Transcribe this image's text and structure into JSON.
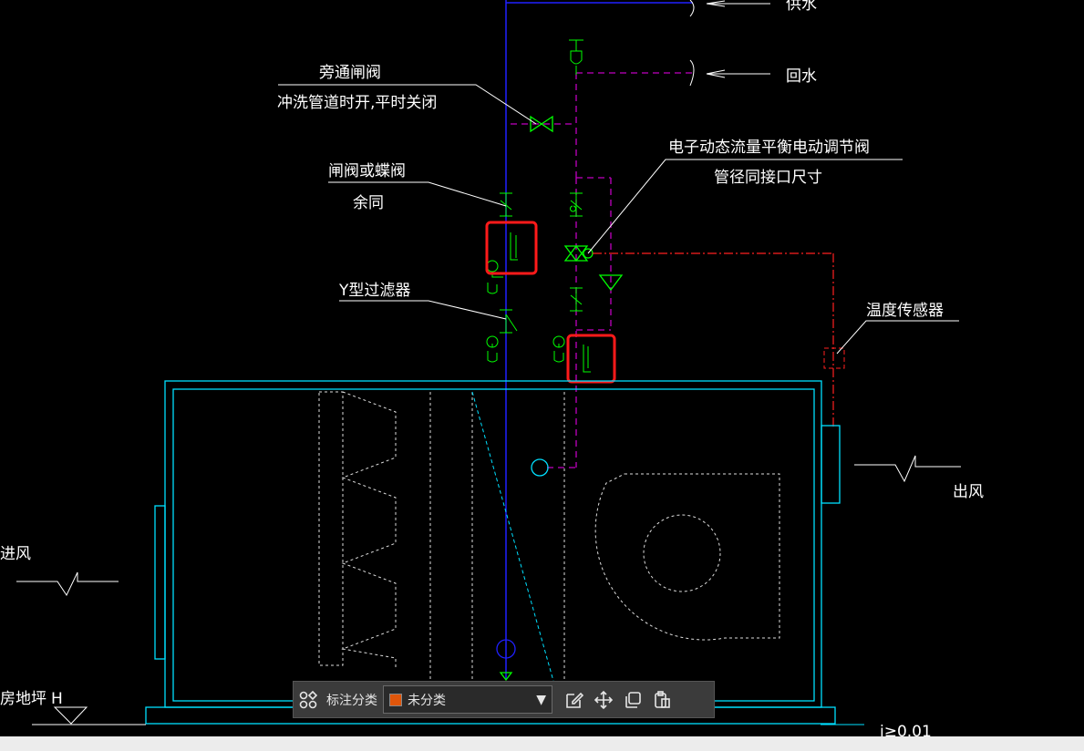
{
  "drawing": {
    "labels": {
      "supply_water": "供水",
      "return_water": "回水",
      "bypass_valve_l1": "旁通闸阀",
      "bypass_valve_l2": "冲洗管道时开,平时关闭",
      "gate_valve_l1": "闸阀或蝶阀",
      "gate_valve_l2": "余同",
      "y_filter": "Y型过滤器",
      "control_valve_l1": "电子动态流量平衡电动调节阀",
      "control_valve_l2": "管径同接口尺寸",
      "temp_sensor": "温度传感器",
      "air_out": "出风",
      "air_in": "进风",
      "floor_label": "房地坪",
      "floor_mark": "H",
      "slope": "i≥0.01"
    },
    "colors": {
      "background": "#000000",
      "supply_pipe": "#0000ff",
      "return_pipe": "#c000c0",
      "valves": "#00ff00",
      "unit_outline": "#00e0ff",
      "control_line": "#ff2020",
      "annotation": "#ffffff",
      "highlight": "#ff0000",
      "swatch": "#e0560b"
    }
  },
  "toolbar": {
    "grid_icon": "grid-apps-icon",
    "label": "标注分类",
    "category_value": "未分类",
    "buttons": [
      "edit-icon",
      "move-icon",
      "copy-icon",
      "paste-icon"
    ]
  }
}
